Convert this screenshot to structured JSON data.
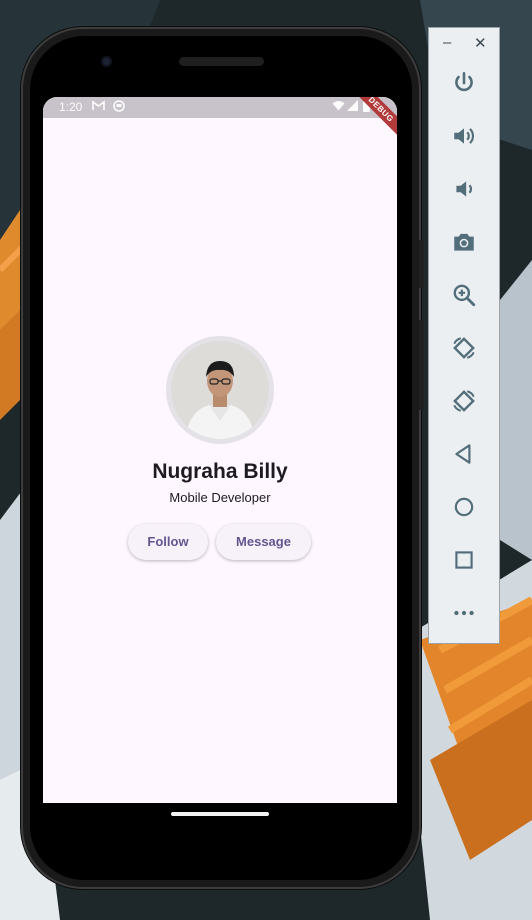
{
  "status_bar": {
    "time": "1:20",
    "debug_banner": "DEBUG"
  },
  "profile": {
    "name": "Nugraha Billy",
    "role": "Mobile Developer",
    "follow_label": "Follow",
    "message_label": "Message"
  },
  "emulator_toolbar": {
    "minimize_glyph": "–",
    "close_glyph": "✕",
    "icons": [
      "power-icon",
      "volume-up-icon",
      "volume-down-icon",
      "camera-icon",
      "zoom-icon",
      "rotate-left-icon",
      "rotate-right-icon",
      "back-icon",
      "home-icon",
      "overview-icon",
      "more-icon"
    ]
  },
  "colors": {
    "screen_background": "#fef7ff",
    "button_text": "#65558f",
    "button_background": "#f7f2fa",
    "status_bar": "#c8c2ca",
    "toolbar_background": "#eceff1",
    "toolbar_icon": "#536e7b",
    "debug_banner": "#b13b3b"
  }
}
